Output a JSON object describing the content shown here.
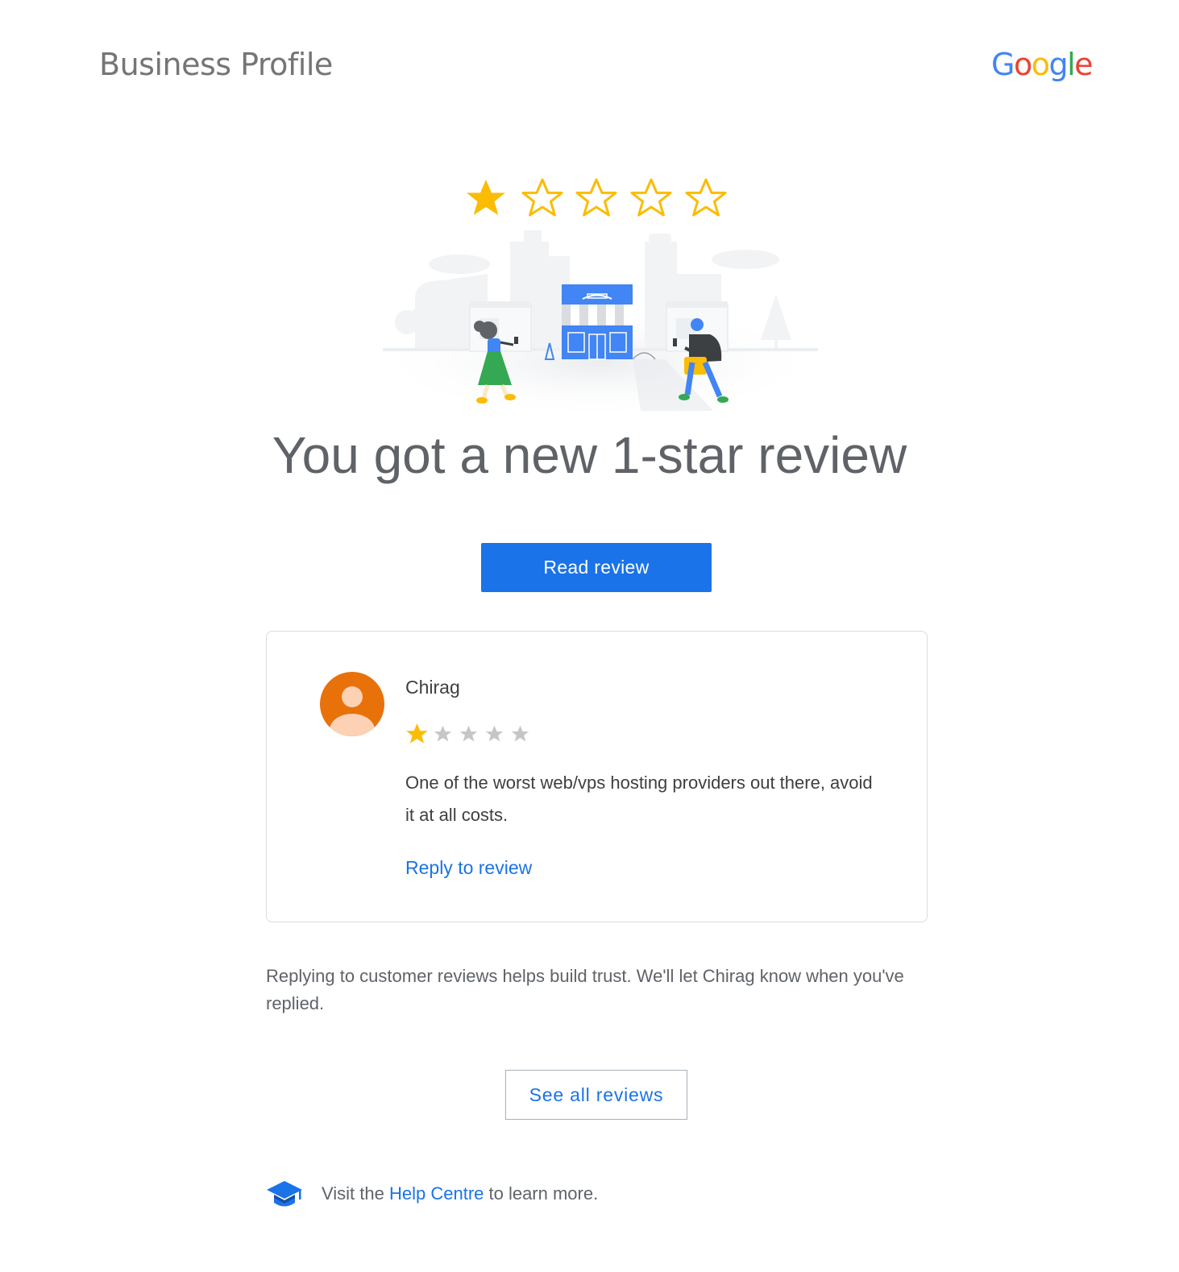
{
  "header": {
    "brand_title": "Business Profile",
    "google_logo": {
      "letters": [
        "G",
        "o",
        "o",
        "g",
        "l",
        "e"
      ],
      "colors": [
        "#4285f4",
        "#ea4335",
        "#fbbc05",
        "#4285f4",
        "#34a853",
        "#ea4335"
      ]
    }
  },
  "hero": {
    "rating": 1,
    "max_rating": 5,
    "star_color": "#fbbc04",
    "illustration": "storefront-with-pedestrians-illustration"
  },
  "headline": "You got a new 1-star review",
  "primary_button": {
    "label": "Read review"
  },
  "review": {
    "reviewer_name": "Chirag",
    "avatar_icon": "person-avatar-icon",
    "avatar_color": "#e8710a",
    "rating": 1,
    "max_rating": 5,
    "text": "One of the worst web/vps hosting providers out there, avoid it at all costs.",
    "reply_link": "Reply to review"
  },
  "info_text": "Replying to customer reviews helps build trust. We'll let Chirag know when you've replied.",
  "secondary_button": {
    "label": "See all reviews"
  },
  "footer": {
    "icon": "graduation-cap-icon",
    "prefix": "Visit the ",
    "link": "Help Centre",
    "suffix": " to learn more."
  },
  "colors": {
    "accent": "#1a73e8",
    "text": "#5f6368",
    "star_filled": "#fbbc04",
    "star_empty": "#c6c6c6"
  }
}
